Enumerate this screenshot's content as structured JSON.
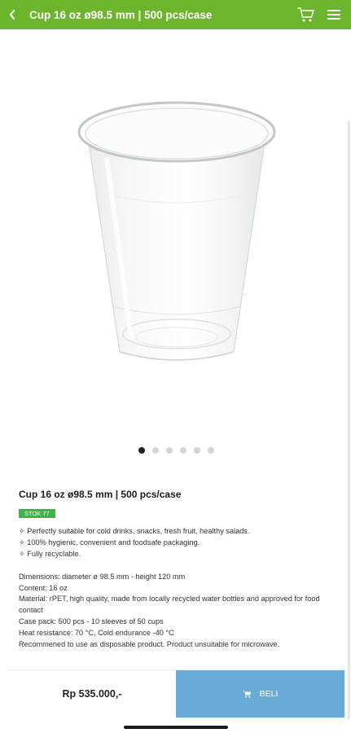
{
  "appbar": {
    "title": "Cup 16 oz ø98.5 mm | 500 pcs/case",
    "back_icon": "chevron-left-icon",
    "cart_icon": "cart-icon",
    "menu_icon": "hamburger-menu-icon",
    "color": "#6cb52d"
  },
  "gallery": {
    "image": "clear plastic cup",
    "slide_count": 6,
    "active_slide": 1
  },
  "product": {
    "title": "Cup 16 oz ø98.5 mm | 500 pcs/case",
    "stock_label": "STOK 77",
    "features": [
      "✧ Perfectly suitable for cold drinks, snacks, fresh fruit, healthy salads.",
      "✧ 100% hygienic, convenient and foodsafe packaging.",
      "✧ Fully recyclable."
    ],
    "specs": [
      "Dimensions: diameter ø 98.5 mm - height 120 mm",
      "Content: 16 oz",
      "Material: rPET, high quality, made from locally recycled water bottles and approved for food contact",
      "Case pack: 500 pcs - 10 sleeves of 50 cups",
      "Heat resistance: 70 °C, Cold endurance -40 °C",
      "Recommened to use as disposable product. Product unsuitable for microwave."
    ]
  },
  "bottom": {
    "price": "Rp 535.000,-",
    "buy_label": "BELI",
    "buy_color": "#6aaad6"
  }
}
